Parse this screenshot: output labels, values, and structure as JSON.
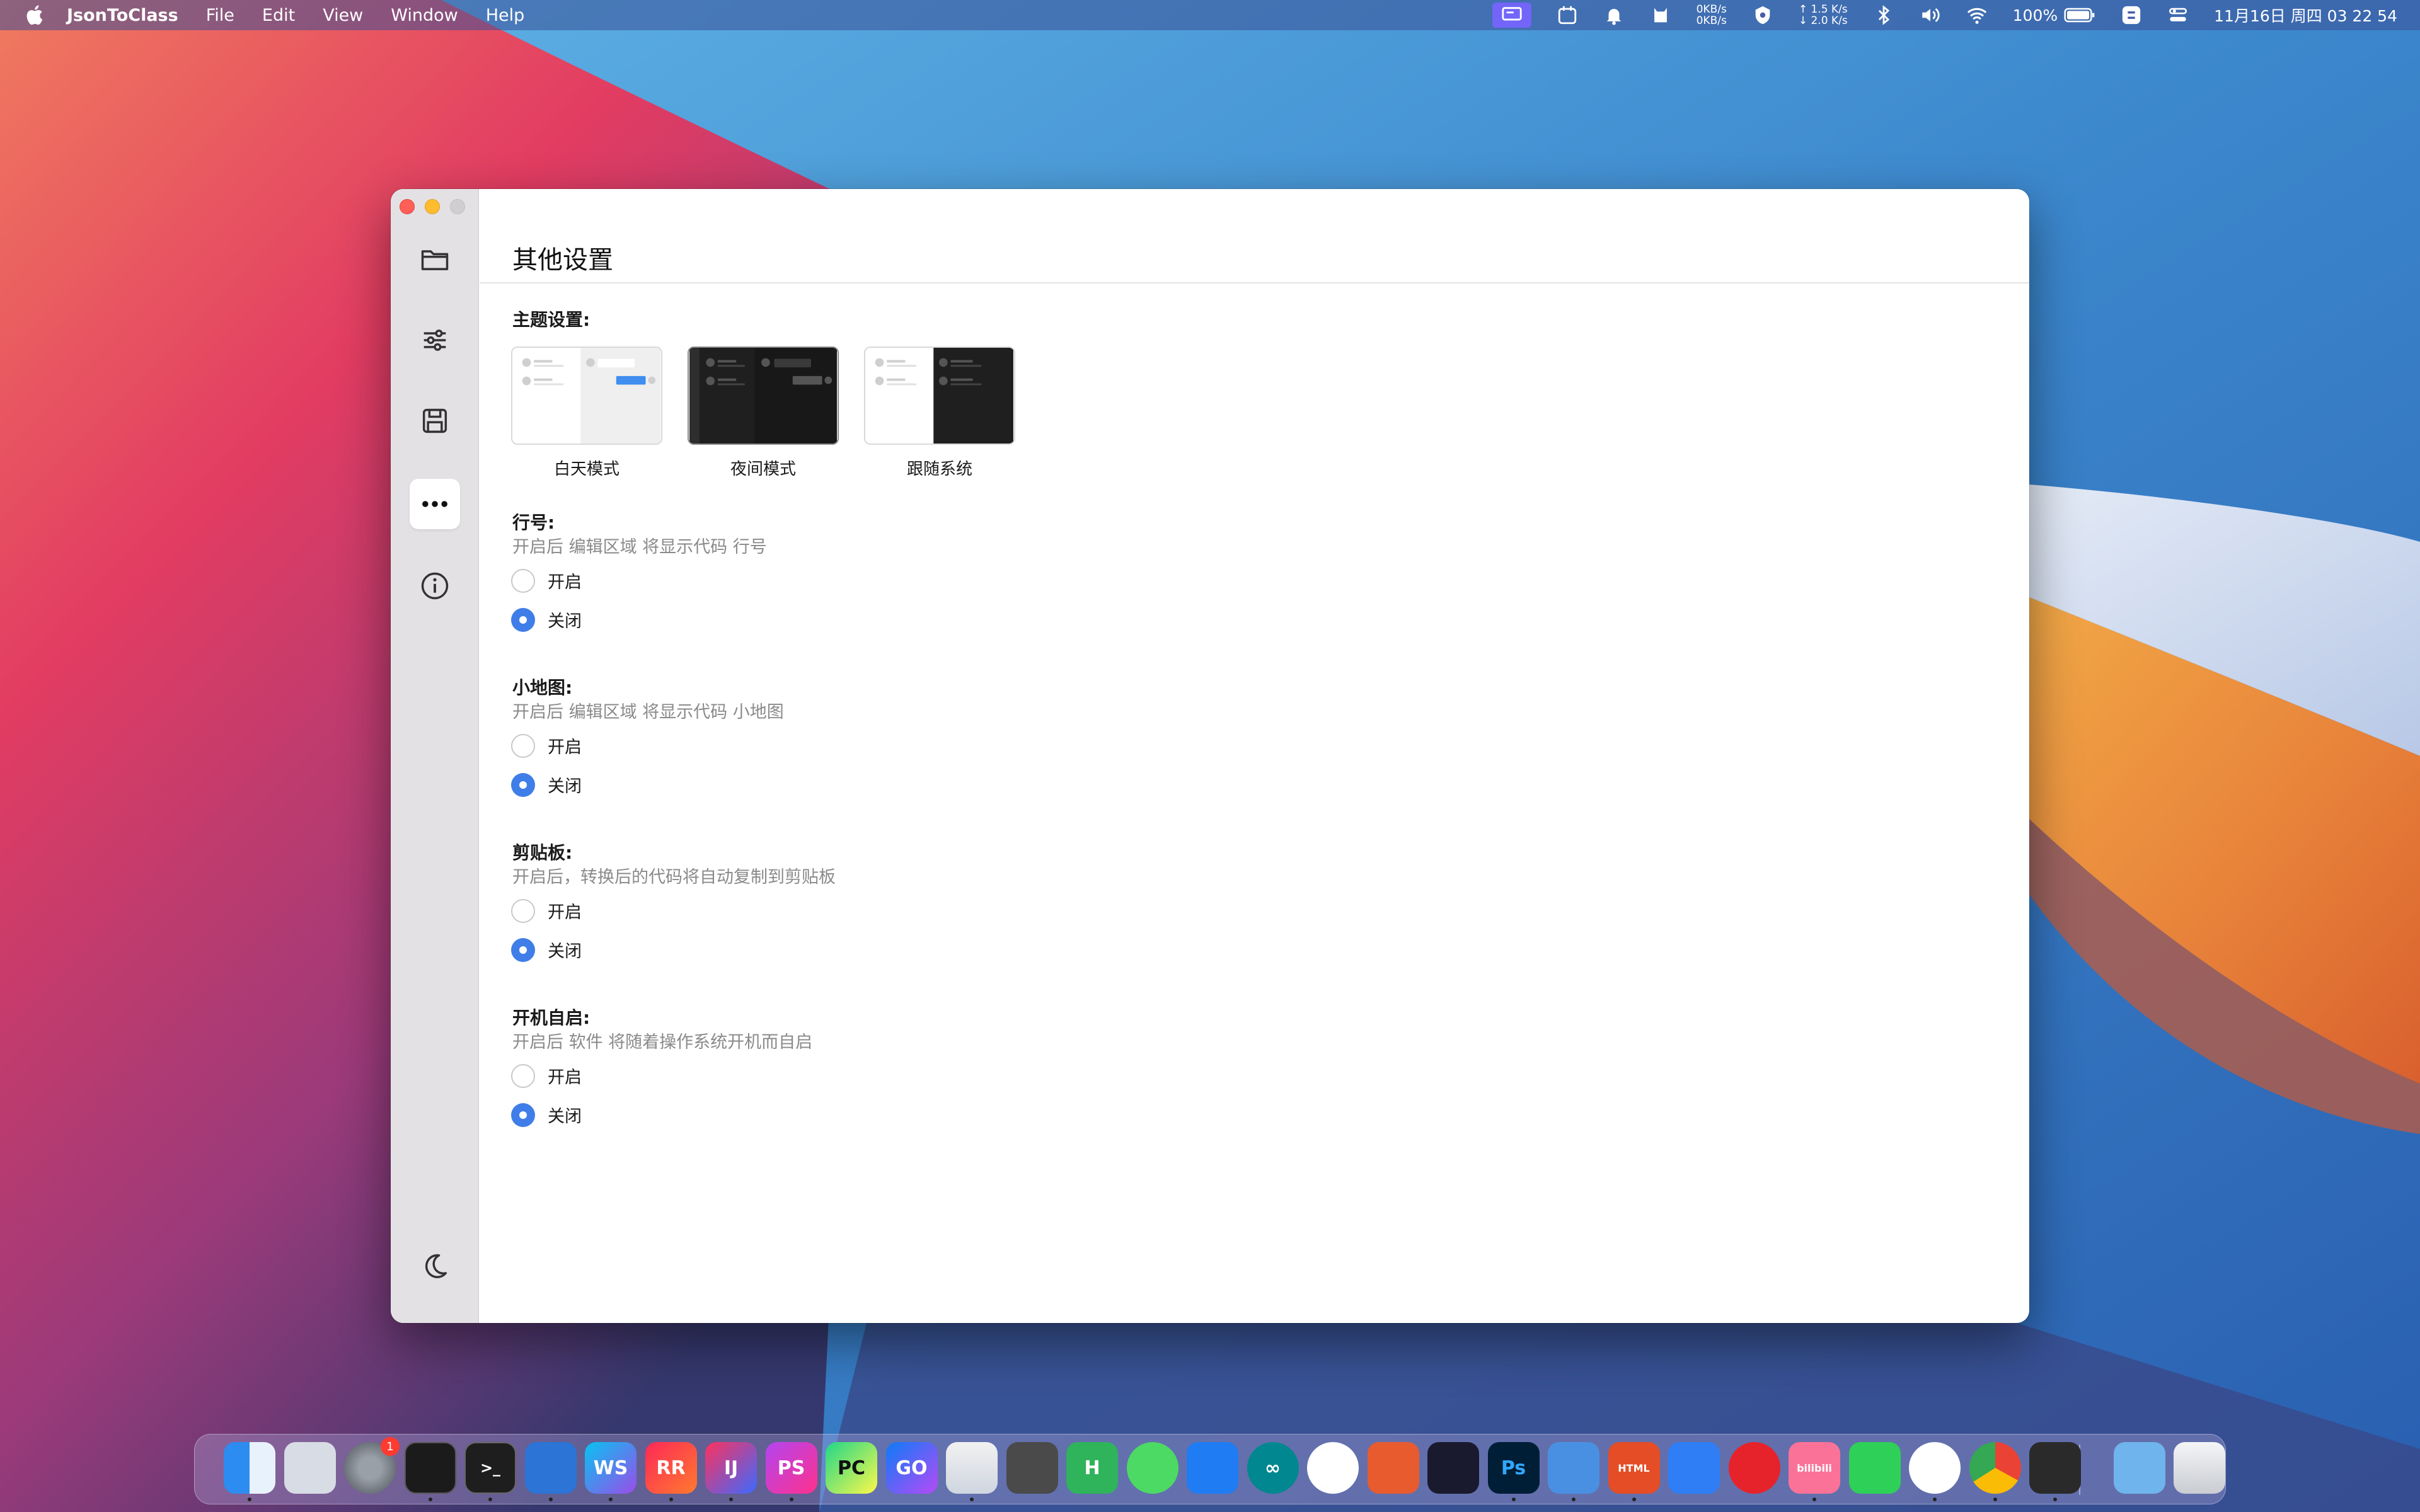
{
  "menubar": {
    "app_name": "JsonToClass",
    "menus": [
      "File",
      "Edit",
      "View",
      "Window",
      "Help"
    ],
    "net_disk": [
      "0KB/s",
      "0KB/s"
    ],
    "net_speed": [
      "↑ 1.5 K/s",
      "↓ 2.0 K/s"
    ],
    "battery": "100%",
    "datetime": "11月16日 周四  03 22 54"
  },
  "window": {
    "page_title": "其他设置",
    "theme": {
      "title": "主题设置:",
      "options": [
        {
          "label": "白天模式",
          "icon": "light-theme-thumb"
        },
        {
          "label": "夜间模式",
          "icon": "dark-theme-thumb"
        },
        {
          "label": "跟随系统",
          "icon": "system-theme-thumb"
        }
      ]
    },
    "settings": [
      {
        "title": "行号:",
        "desc": "开启后 编辑区域 将显示代码 行号",
        "on_label": "开启",
        "off_label": "关闭",
        "selected": "off"
      },
      {
        "title": "小地图:",
        "desc": "开启后 编辑区域 将显示代码 小地图",
        "on_label": "开启",
        "off_label": "关闭",
        "selected": "off"
      },
      {
        "title": "剪贴板:",
        "desc": "开启后，转换后的代码将自动复制到剪贴板",
        "on_label": "开启",
        "off_label": "关闭",
        "selected": "off"
      },
      {
        "title": "开机自启:",
        "desc": "开启后 软件 将随着操作系统开机而自启",
        "on_label": "开启",
        "off_label": "关闭",
        "selected": "off"
      }
    ],
    "sidebar": {
      "items": [
        "folder-icon",
        "sliders-icon",
        "save-icon",
        "more-icon",
        "info-icon"
      ],
      "active": "more-icon",
      "footer": "moon-icon"
    }
  },
  "dock": {
    "apps": [
      {
        "name": "finder",
        "label": ""
      },
      {
        "name": "launchpad",
        "label": ""
      },
      {
        "name": "system-preferences",
        "label": "",
        "badge": "1"
      },
      {
        "name": "activity-monitor",
        "label": ""
      },
      {
        "name": "terminal",
        "label": ">_"
      },
      {
        "name": "vscode",
        "label": ""
      },
      {
        "name": "webstorm",
        "label": "WS"
      },
      {
        "name": "rustrover",
        "label": "RR"
      },
      {
        "name": "intellij",
        "label": "IJ"
      },
      {
        "name": "phpstorm",
        "label": "PS"
      },
      {
        "name": "pycharm",
        "label": "PC"
      },
      {
        "name": "goland",
        "label": "GO"
      },
      {
        "name": "xcode-instruments",
        "label": ""
      },
      {
        "name": "sublime-text",
        "label": ""
      },
      {
        "name": "hbuilder",
        "label": "H"
      },
      {
        "name": "messages",
        "label": ""
      },
      {
        "name": "app-store-dev",
        "label": ""
      },
      {
        "name": "arduino",
        "label": "∞"
      },
      {
        "name": "nutstore",
        "label": ""
      },
      {
        "name": "pencil",
        "label": ""
      },
      {
        "name": "chatgpt",
        "label": ""
      },
      {
        "name": "photoshop",
        "label": "Ps"
      },
      {
        "name": "lark",
        "label": ""
      },
      {
        "name": "html-app",
        "label": "HTML"
      },
      {
        "name": "cat-app",
        "label": ""
      },
      {
        "name": "netease-music",
        "label": ""
      },
      {
        "name": "bilibili",
        "label": "bilibili"
      },
      {
        "name": "wechat",
        "label": ""
      },
      {
        "name": "qq",
        "label": ""
      },
      {
        "name": "chrome",
        "label": ""
      },
      {
        "name": "sidebar-app",
        "label": ""
      },
      {
        "name": "downloads-folder",
        "label": ""
      },
      {
        "name": "trash",
        "label": ""
      }
    ]
  },
  "colors": {
    "accent": "#3f7ee8",
    "sidebar_bg": "#e3e1e4",
    "close": "#fe5f57",
    "minimize": "#febc2e"
  }
}
